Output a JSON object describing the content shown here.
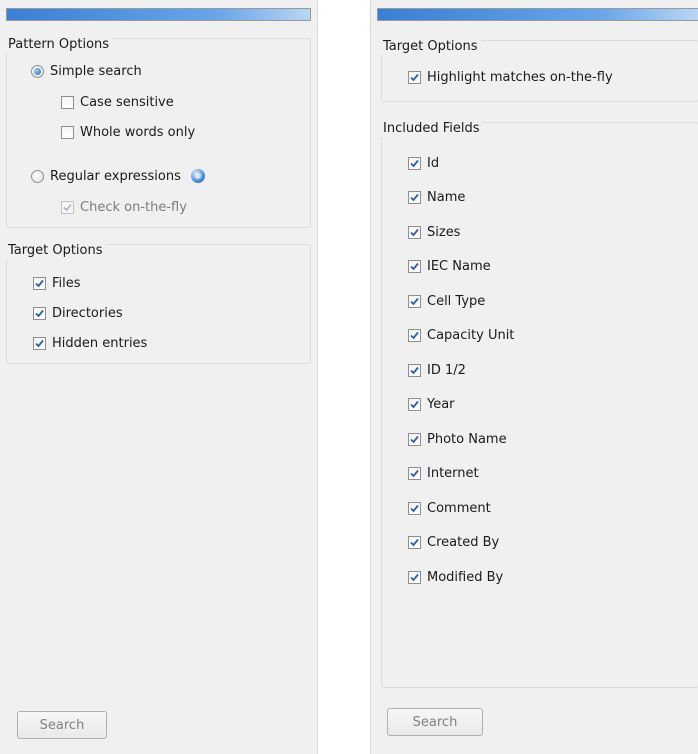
{
  "left": {
    "search_progress": 1.0,
    "pattern_options": {
      "legend": "Pattern Options",
      "simple_search": {
        "label": "Simple search",
        "selected": true
      },
      "case_sensitive": {
        "label": "Case sensitive",
        "checked": false
      },
      "whole_words": {
        "label": "Whole words only",
        "checked": false
      },
      "regex": {
        "label": "Regular expressions",
        "selected": false
      },
      "check_on_the_fly": {
        "label": "Check on-the-fly",
        "checked": true,
        "disabled": true
      }
    },
    "target_options": {
      "legend": "Target Options",
      "items": [
        {
          "label": "Files",
          "checked": true
        },
        {
          "label": "Directories",
          "checked": true
        },
        {
          "label": "Hidden entries",
          "checked": true
        }
      ]
    },
    "search_button": "Search"
  },
  "right": {
    "search_progress": 1.0,
    "target_options": {
      "legend": "Target Options",
      "highlight": {
        "label": "Highlight matches on-the-fly",
        "checked": true
      }
    },
    "included_fields": {
      "legend": "Included Fields",
      "items": [
        {
          "label": "Id",
          "checked": true
        },
        {
          "label": "Name",
          "checked": true
        },
        {
          "label": "Sizes",
          "checked": true
        },
        {
          "label": "IEC Name",
          "checked": true
        },
        {
          "label": "Cell Type",
          "checked": true
        },
        {
          "label": "Capacity Unit",
          "checked": true
        },
        {
          "label": "ID 1/2",
          "checked": true
        },
        {
          "label": "Year",
          "checked": true
        },
        {
          "label": "Photo Name",
          "checked": true
        },
        {
          "label": "Internet",
          "checked": true
        },
        {
          "label": "Comment",
          "checked": true
        },
        {
          "label": "Created By",
          "checked": true
        },
        {
          "label": "Modified By",
          "checked": true
        }
      ]
    },
    "search_button": "Search"
  },
  "colors": {
    "panel_bg": "#f0f0f0",
    "progress_blue": "#3a7fd5",
    "check_color": "#2e5fa8",
    "disabled_text": "#7c7c7c"
  }
}
